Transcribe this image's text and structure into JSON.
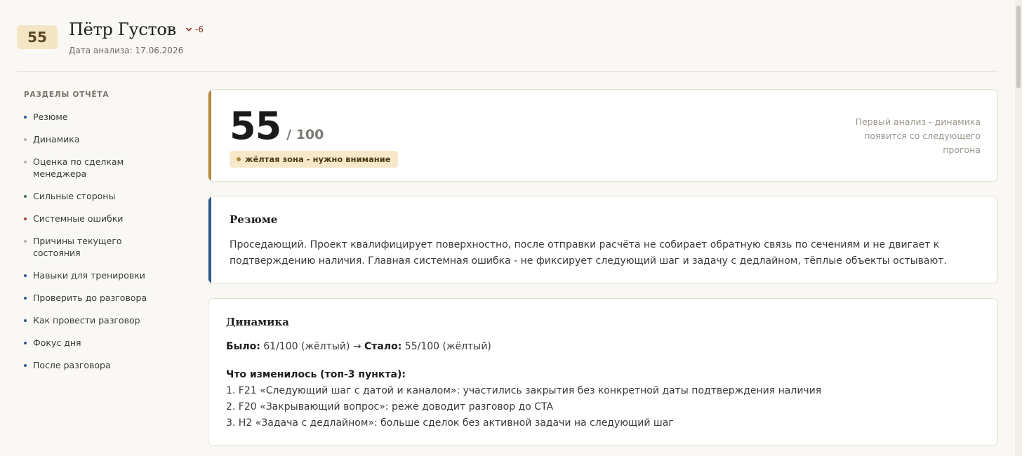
{
  "header": {
    "score": "55",
    "name": "Пётр Густов",
    "trend": "-6",
    "date": "Дата анализа: 17.06.2026"
  },
  "sidebar": {
    "title": "РАЗДЕЛЫ ОТЧЁТА",
    "items": [
      {
        "label": "Резюме",
        "color": "#2b5a8e"
      },
      {
        "label": "Динамика",
        "color": "#b9b2a6"
      },
      {
        "label": "Оценка по сделкам менеджера",
        "color": "#b9b2a6"
      },
      {
        "label": "Сильные стороны",
        "color": "#3c7a52"
      },
      {
        "label": "Системные ошибки",
        "color": "#a5432f"
      },
      {
        "label": "Причины текущего состояния",
        "color": "#b9b2a6"
      },
      {
        "label": "Навыки для тренировки",
        "color": "#2b5a8e"
      },
      {
        "label": "Проверить до разговора",
        "color": "#2b5a8e"
      },
      {
        "label": "Как провести разговор",
        "color": "#2b5a8e"
      },
      {
        "label": "Фокус дня",
        "color": "#2b5a8e"
      },
      {
        "label": "После разговора",
        "color": "#2b5a8e"
      }
    ]
  },
  "score_card": {
    "value": "55",
    "of": "/ 100",
    "zone_label": "жёлтая зона - нужно внимание",
    "note": "Первый анализ - динамика появится со следующего прогона",
    "accent": "#b58a3e"
  },
  "summary": {
    "title": "Резюме",
    "text": "Проседающий. Проект квалифицирует поверхностно, после отправки расчёта не собирает обратную связь по сечениям и не двигает к подтверждению наличия. Главная системная ошибка - не фиксирует следующий шаг и задачу с дедлайном, тёплые объекты остывают.",
    "accent": "#2b5a8e"
  },
  "dynamics": {
    "title": "Динамика",
    "was_label": "Было:",
    "was_value": "61/100 (жёлтый) →",
    "now_label": "Стало:",
    "now_value": "55/100 (жёлтый)",
    "changes_title": "Что изменилось (топ-3 пункта):",
    "changes": [
      "1. F21 «Следующий шаг с датой и каналом»: участились закрытия без конкретной даты подтверждения наличия",
      "2. F20 «Закрывающий вопрос»: реже доводит разговор до CTA",
      "3. H2 «Задача с дедлайном»: больше сделок без активной задачи на следующий шаг"
    ]
  }
}
